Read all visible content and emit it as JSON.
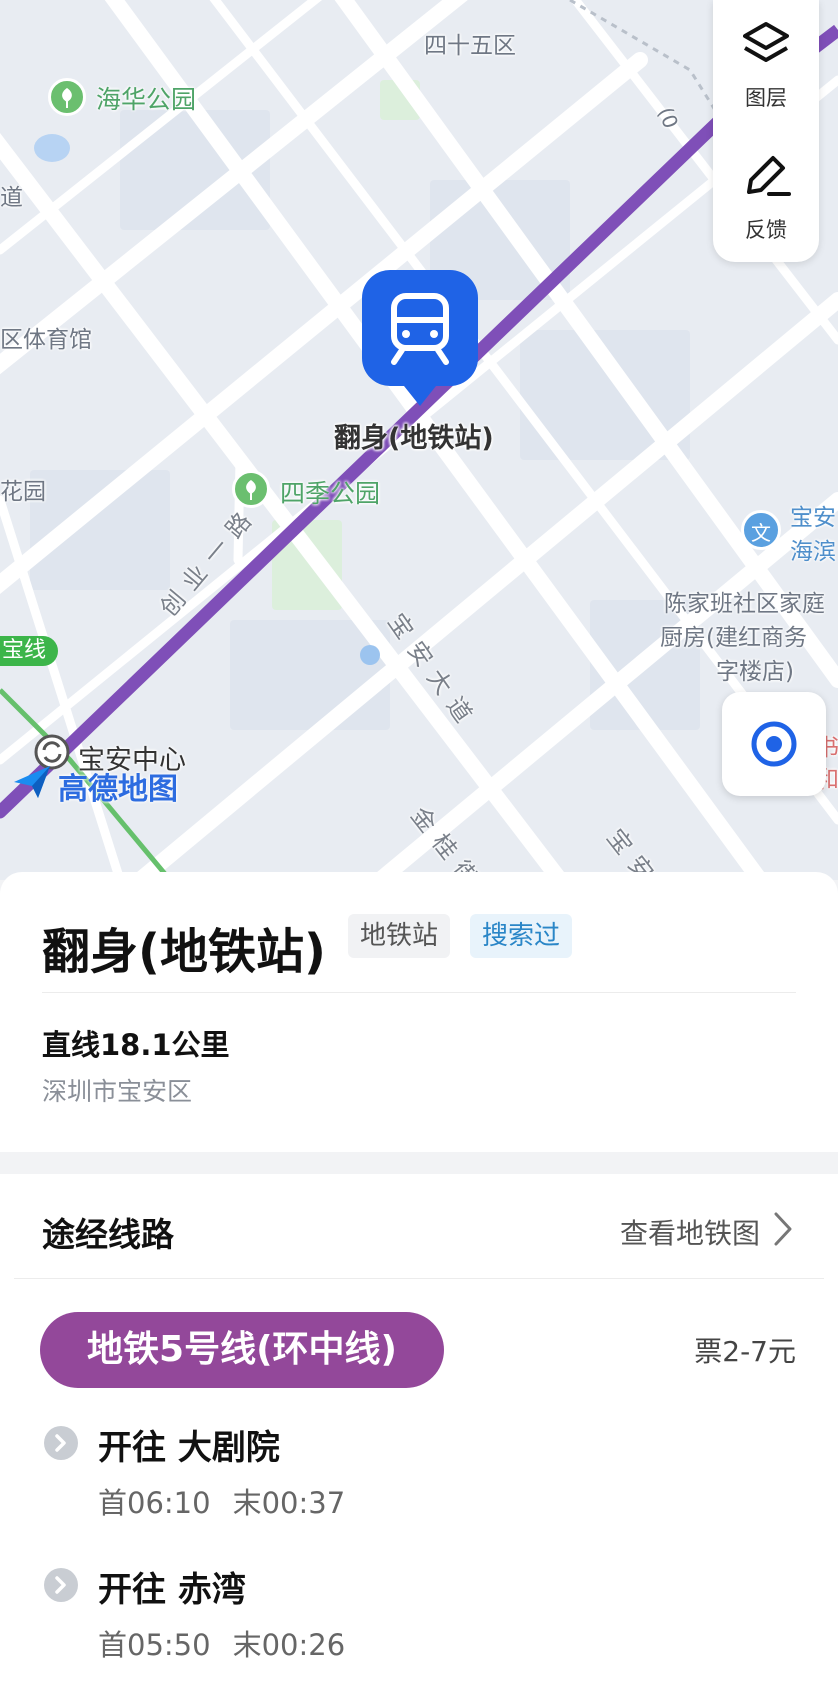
{
  "map": {
    "layer_label": "图层",
    "feedback_label": "反馈",
    "pin_label": "翻身(地铁站)",
    "labels": {
      "district_45": "四十五区",
      "haihua_park": "海华公园",
      "road_dao": "道",
      "gym": "区体育馆",
      "garden": "花园",
      "siji_park": "四季公园",
      "line_badge": "宝线",
      "chuangye_road": "创业一路",
      "baoan_avenue": "宝安大道",
      "baoan_center": "宝安中心",
      "jingui": "金桂街",
      "bao_bottom": "宝安",
      "edu_text_1": "宝安",
      "edu_text_2": "海滨",
      "edu_icon": "文",
      "restaurant_1": "陈家班社区家庭",
      "restaurant_2": "厨房(建红商务",
      "restaurant_3": "字楼店)",
      "right_edge_1": "书",
      "right_edge_2": "和",
      "top_right_fragment": "(0"
    },
    "logo": "高德地图",
    "colors": {
      "metro_line": "#7f4fb8",
      "pin": "#1f63e6",
      "park": "#6bbf6f"
    }
  },
  "poi": {
    "name": "翻身(地铁站)",
    "tag_type": "地铁站",
    "tag_history": "搜索过",
    "distance": "直线18.1公里",
    "address": "深圳市宝安区"
  },
  "routes": {
    "section_title": "途经线路",
    "view_metro_map": "查看地铁图",
    "line": {
      "name": "地铁5号线(环中线)",
      "fare": "票2-7元",
      "color": "#93489a"
    },
    "directions": [
      {
        "to": "开往 大剧院",
        "first": "首06:10",
        "last": "末00:37"
      },
      {
        "to": "开往 赤湾",
        "first": "首05:50",
        "last": "末00:26"
      }
    ]
  }
}
